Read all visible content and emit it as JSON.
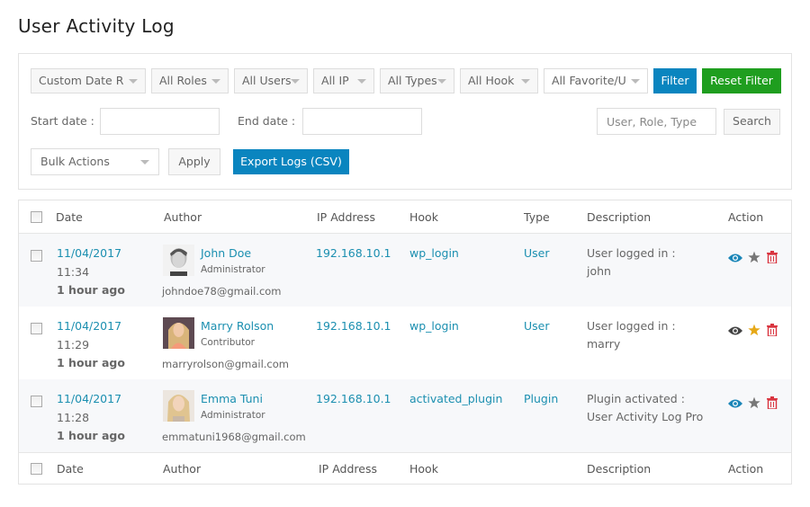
{
  "page": {
    "title": "User Activity Log"
  },
  "filters": {
    "date_range": "Custom Date R",
    "roles": "All Roles",
    "users": "All Users",
    "ip": "All IP",
    "types": "All Types",
    "hook": "All Hook",
    "favorite": "All Favorite/U",
    "filter_label": "Filter",
    "reset_label": "Reset Filter",
    "start_date_label": "Start date :",
    "start_date_value": "",
    "end_date_label": "End date :",
    "end_date_value": "",
    "search_placeholder": "User, Role, Type",
    "search_value": "",
    "search_label": "Search",
    "bulk_actions": "Bulk Actions",
    "apply_label": "Apply",
    "export_label": "Export Logs (CSV)"
  },
  "colors": {
    "accent_blue": "#0a85bf",
    "accent_green": "#1f9e1f",
    "link": "#1b8fb0",
    "delete": "#d9343f",
    "favorite": "#e6a817"
  },
  "table": {
    "headers": [
      "Date",
      "Author",
      "IP Address",
      "Hook",
      "Type",
      "Description",
      "Action"
    ],
    "footer_headers": [
      "Date",
      "Author",
      "IP Address",
      "Hook",
      "Description",
      "Action"
    ],
    "rows": [
      {
        "date": "11/04/2017",
        "time": "11:34",
        "ago": "1 hour ago",
        "name": "John Doe",
        "role": "Administrator",
        "email": "johndoe78@gmail.com",
        "ip": "192.168.10.1",
        "hook": "wp_login",
        "type": "User",
        "desc1": "User logged in :",
        "desc2": "john",
        "favorite": false,
        "viewed": true
      },
      {
        "date": "11/04/2017",
        "time": "11:29",
        "ago": "1 hour ago",
        "name": "Marry Rolson",
        "role": "Contributor",
        "email": "marryrolson@gmail.com",
        "ip": "192.168.10.1",
        "hook": "wp_login",
        "type": "User",
        "desc1": "User logged in :",
        "desc2": "marry",
        "favorite": true,
        "viewed": false
      },
      {
        "date": "11/04/2017",
        "time": "11:28",
        "ago": "1 hour ago",
        "name": "Emma Tuni",
        "role": "Administrator",
        "email": "emmatuni1968@gmail.com",
        "ip": "192.168.10.1",
        "hook": "activated_plugin",
        "type": "Plugin",
        "desc1": "Plugin activated :",
        "desc2": "User Activity Log Pro",
        "favorite": false,
        "viewed": true
      }
    ]
  }
}
